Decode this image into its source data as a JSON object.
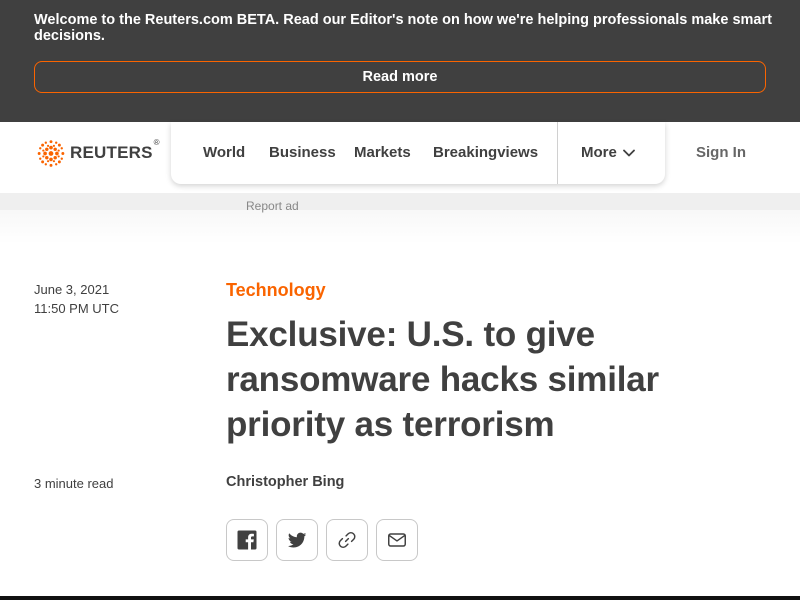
{
  "banner": {
    "message": "Welcome to the Reuters.com BETA. Read our Editor's note on how we're helping professionals make smart decisions.",
    "read_more_label": "Read more"
  },
  "header": {
    "logo_text": "REUTERS",
    "logo_reg": "®",
    "nav": [
      "World",
      "Business",
      "Markets",
      "Breakingviews"
    ],
    "more_label": "More",
    "sign_in_label": "Sign In"
  },
  "ad": {
    "report_label": "Report ad"
  },
  "article": {
    "date": "June 3, 2021",
    "time": "11:50 PM UTC",
    "category": "Technology",
    "headline": "Exclusive: U.S. to give ransomware hacks similar priority as terrorism",
    "read_time": "3 minute read",
    "author": "Christopher Bing",
    "share_icons": [
      "facebook-icon",
      "twitter-icon",
      "link-icon",
      "email-icon"
    ]
  },
  "colors": {
    "accent": "#fa6400",
    "banner_bg": "#404040",
    "text": "#404040"
  }
}
